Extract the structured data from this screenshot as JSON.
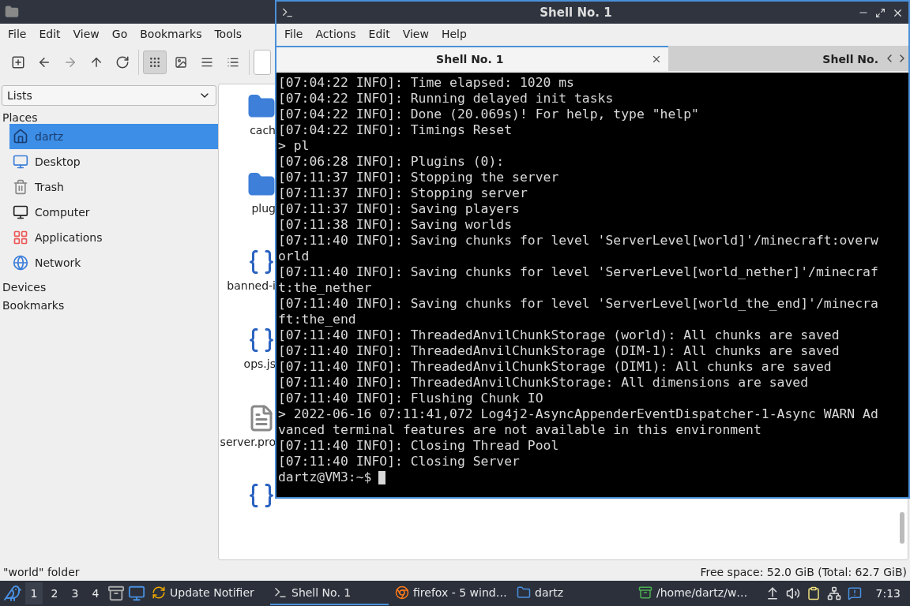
{
  "file_manager": {
    "menu": [
      "File",
      "Edit",
      "View",
      "Go",
      "Bookmarks",
      "Tools"
    ],
    "view_buttons": [
      {
        "selected": true
      },
      {
        "selected": false
      },
      {
        "selected": false
      },
      {
        "selected": false
      }
    ],
    "sidebar": {
      "selector": "Lists",
      "sections": [
        {
          "title": "Places",
          "items": [
            {
              "label": "dartz",
              "selected": true
            },
            {
              "label": "Desktop",
              "selected": false
            },
            {
              "label": "Trash",
              "selected": false
            },
            {
              "label": "Computer",
              "selected": false
            },
            {
              "label": "Applications",
              "selected": false
            },
            {
              "label": "Network",
              "selected": false
            }
          ]
        },
        {
          "title": "Devices"
        },
        {
          "title": "Bookmarks"
        }
      ]
    },
    "files": [
      {
        "label": "cach",
        "kind": "folder"
      },
      {
        "label": "plug",
        "kind": "folder"
      },
      {
        "label": "banned-i",
        "kind": "json"
      },
      {
        "label": "ops.js",
        "kind": "json"
      },
      {
        "label": "server.pro",
        "kind": "text"
      },
      {
        "kind": "json"
      }
    ],
    "status": {
      "left": "\"world\" folder",
      "right": "Free space: 52.0 GiB (Total: 62.7 GiB)"
    }
  },
  "terminal": {
    "title": "Shell No. 1",
    "menu": [
      "File",
      "Actions",
      "Edit",
      "View",
      "Help"
    ],
    "tabs": [
      {
        "label": "Shell No. 1",
        "selected": true
      },
      {
        "label": "Shell No.",
        "selected": false
      }
    ],
    "lines": [
      "[07:04:22 INFO]: Time elapsed: 1020 ms",
      "[07:04:22 INFO]: Running delayed init tasks",
      "[07:04:22 INFO]: Done (20.069s)! For help, type \"help\"",
      "[07:04:22 INFO]: Timings Reset",
      "> pl",
      "[07:06:28 INFO]: Plugins (0):",
      "[07:11:37 INFO]: Stopping the server",
      "[07:11:37 INFO]: Stopping server",
      "[07:11:37 INFO]: Saving players",
      "[07:11:38 INFO]: Saving worlds",
      "[07:11:40 INFO]: Saving chunks for level 'ServerLevel[world]'/minecraft:overw",
      "orld",
      "[07:11:40 INFO]: Saving chunks for level 'ServerLevel[world_nether]'/minecraf",
      "t:the_nether",
      "[07:11:40 INFO]: Saving chunks for level 'ServerLevel[world_the_end]'/minecra",
      "ft:the_end",
      "[07:11:40 INFO]: ThreadedAnvilChunkStorage (world): All chunks are saved",
      "[07:11:40 INFO]: ThreadedAnvilChunkStorage (DIM-1): All chunks are saved",
      "[07:11:40 INFO]: ThreadedAnvilChunkStorage (DIM1): All chunks are saved",
      "[07:11:40 INFO]: ThreadedAnvilChunkStorage: All dimensions are saved",
      "[07:11:40 INFO]: Flushing Chunk IO",
      "> 2022-06-16 07:11:41,072 Log4j2-AsyncAppenderEventDispatcher-1-Async WARN Ad",
      "vanced terminal features are not available in this environment",
      "[07:11:40 INFO]: Closing Thread Pool",
      "[07:11:40 INFO]: Closing Server"
    ],
    "prompt": "dartz@VM3:~$"
  },
  "taskbar": {
    "workspaces": [
      {
        "label": "1",
        "selected": true
      },
      {
        "label": "2",
        "selected": false
      },
      {
        "label": "3",
        "selected": false
      },
      {
        "label": "4",
        "selected": false
      }
    ],
    "tasks": [
      {
        "label": "Update Notifier",
        "kind": "update",
        "selected": false
      },
      {
        "label": "Shell No. 1",
        "kind": "terminal",
        "selected": true
      },
      {
        "label": "firefox - 5 wind…",
        "kind": "browser",
        "selected": false
      },
      {
        "label": "dartz",
        "kind": "folder",
        "selected": false
      },
      {
        "label": "/home/dartz/w…",
        "kind": "archive",
        "selected": false
      }
    ],
    "clock": "7:13"
  }
}
